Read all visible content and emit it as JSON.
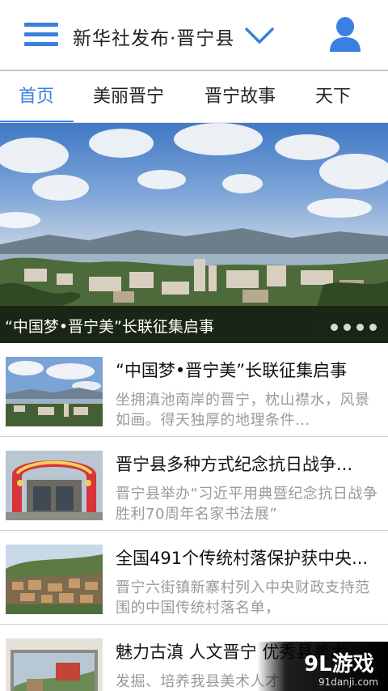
{
  "header": {
    "title": "新华社发布·晋宁县",
    "accent_color": "#3b7fe0",
    "menu_icon": "hamburger-menu-icon",
    "dropdown_icon": "chevron-down-icon",
    "account_icon": "user-icon"
  },
  "tabs": [
    {
      "label": "首页",
      "active": true
    },
    {
      "label": "美丽晋宁",
      "active": false
    },
    {
      "label": "晋宁故事",
      "active": false
    },
    {
      "label": "天下",
      "active": false
    }
  ],
  "banner": {
    "caption": "“中国梦•晋宁美”长联征集启事",
    "slide_count": 5,
    "active_slide": 1
  },
  "news": [
    {
      "title": "“中国梦•晋宁美”长联征集启事",
      "summary": "坐拥滇池南岸的晋宁，枕山襟水，风景如画。得天独厚的地理条件..."
    },
    {
      "title": "晋宁县多种方式纪念抗日战争...",
      "summary": "晋宁县举办“习近平用典暨纪念抗日战争胜利70周年名家书法展”"
    },
    {
      "title": "全国491个传统村落保护获中央...",
      "summary": "晋宁六街镇新寨村列入中央财政支持范围的中国传统村落名单，"
    },
    {
      "title": "魅力古滇 人文晋宁 优秀县美术...",
      "summary": "发掘、培养我县美术人才"
    }
  ],
  "watermark": {
    "logo": "9L游戏",
    "url": "91danji.com"
  }
}
